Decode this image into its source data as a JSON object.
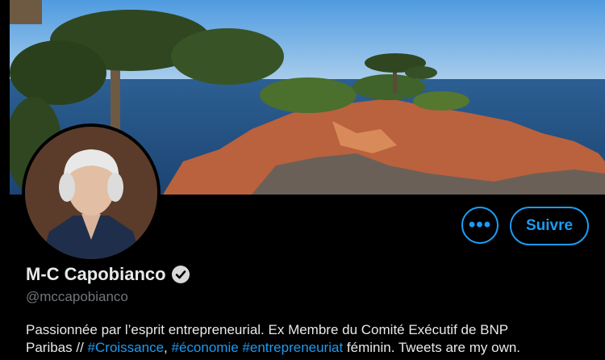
{
  "profile": {
    "display_name": "M-C Capobianco",
    "handle": "@mccapobianco",
    "verified_icon": "verified-badge-icon",
    "bio": {
      "line1": "Passionnée par l’esprit entrepreneurial. Ex Membre du Comité Exécutif de BNP",
      "line2_prefix": "Paribas //",
      "tag1": "#Croissance",
      "comma": ",",
      "tag2": "#économie",
      "tag3": "#entrepreneuriat",
      "line2_suffix": "féminin. Tweets are my own."
    }
  },
  "actions": {
    "more_label": "•••",
    "follow_label": "Suivre"
  },
  "colors": {
    "accent": "#1d9bf0",
    "background": "#000000",
    "text": "#e7e9ea",
    "muted": "#71767b"
  }
}
